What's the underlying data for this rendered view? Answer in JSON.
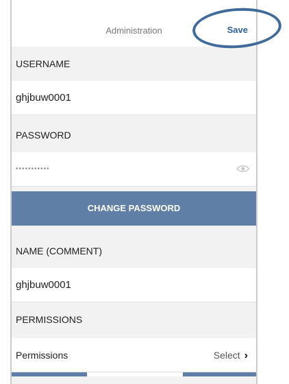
{
  "header": {
    "title": "Administration",
    "save_label": "Save"
  },
  "sections": {
    "username_label": "USERNAME",
    "username_value": "ghjbuw0001",
    "password_label": "PASSWORD",
    "password_mask": "•••••••••••",
    "change_password_label": "CHANGE PASSWORD",
    "name_label": "NAME (COMMENT)",
    "name_value": "ghjbuw0001",
    "permissions_label": "PERMISSIONS",
    "permissions_row_label": "Permissions",
    "permissions_select": "Select"
  },
  "colors": {
    "accent": "#2e5fa1",
    "button": "#5f7fa6",
    "ring": "#3f6a99"
  },
  "icons": {
    "eye": "eye-icon",
    "chevron": "chevron-right-icon"
  }
}
